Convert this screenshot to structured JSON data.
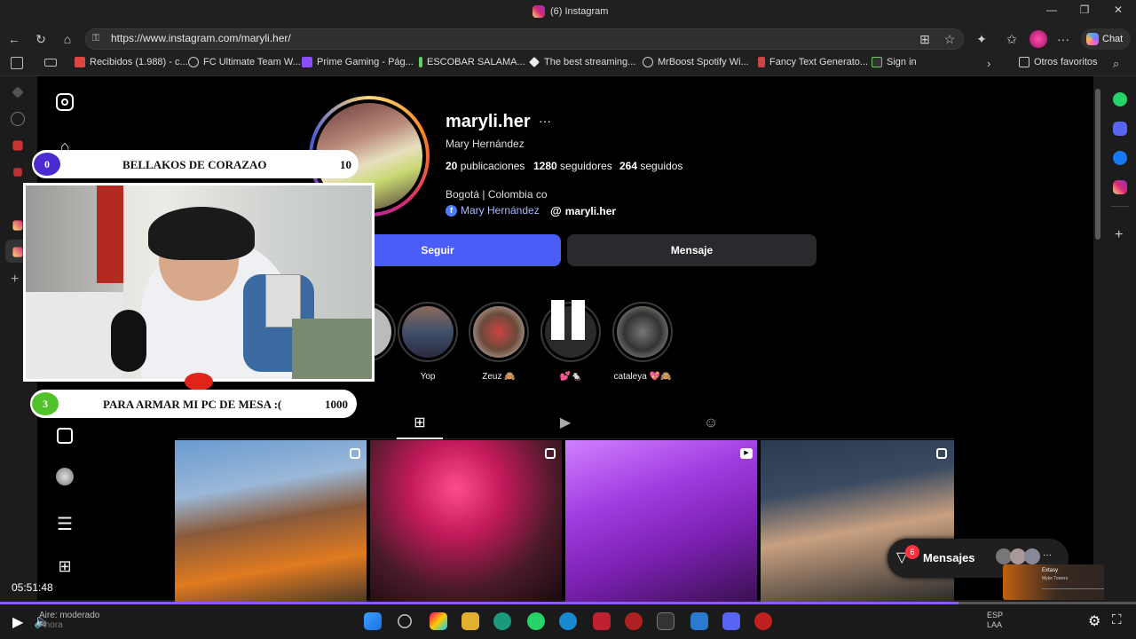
{
  "browser": {
    "tab_title": "(6) Instagram",
    "url": "https://www.instagram.com/maryli.her/",
    "chat_label": "Chat",
    "bookmarks": [
      "Recibidos (1.988) - c...",
      "FC Ultimate Team W...",
      "Prime Gaming - Pág...",
      "ESCOBAR SALAMA...",
      "The best streaming...",
      "MrBoost Spotify Wi...",
      "Fancy Text Generato...",
      "Sign in"
    ],
    "other_favorites": "Otros favoritos",
    "window_controls": [
      "—",
      "❐",
      "✕"
    ]
  },
  "profile": {
    "username": "maryli.her",
    "more_icon": "···",
    "full_name": "Mary Hernández",
    "posts_count": "20",
    "posts_label": "publicaciones",
    "followers_count": "1280",
    "followers_label": "seguidores",
    "following_count": "264",
    "following_label": "seguidos",
    "bio": "Bogotá | Colombia co",
    "facebook_link": "Mary Hernández",
    "threads_link": "maryli.her",
    "follow_button": "Seguir",
    "message_button": "Mensaje"
  },
  "highlights": [
    {
      "label": "Yop"
    },
    {
      "label": "Zeuz 🙈"
    },
    {
      "label": "💕🐁"
    },
    {
      "label": "cataleya 💖🙈"
    }
  ],
  "overlay": {
    "goal1": {
      "current": "0",
      "title": "BELLAKOS DE CORAZAO",
      "target": "10"
    },
    "goal2": {
      "current": "3",
      "title": "PARA ARMAR MI PC DE MESA :(",
      "target": "1000"
    }
  },
  "messages_widget": {
    "label": "Mensajes",
    "badge": "6",
    "more": "···"
  },
  "video": {
    "timestamp": "05:51:48",
    "progress": 0.844,
    "weather_line1": "Aire: moderado",
    "weather_line2": "Ahora",
    "lang_line1": "ESP",
    "lang_line2": "LAA",
    "mini_player_title": "Extasy",
    "mini_player_artist": "Myke Towers"
  },
  "colors": {
    "follow_blue": "#4a5df9",
    "progress_purple": "#8a5cf6",
    "goal1_circle": "#4b2bd1",
    "goal2_circle": "#52c22b"
  }
}
